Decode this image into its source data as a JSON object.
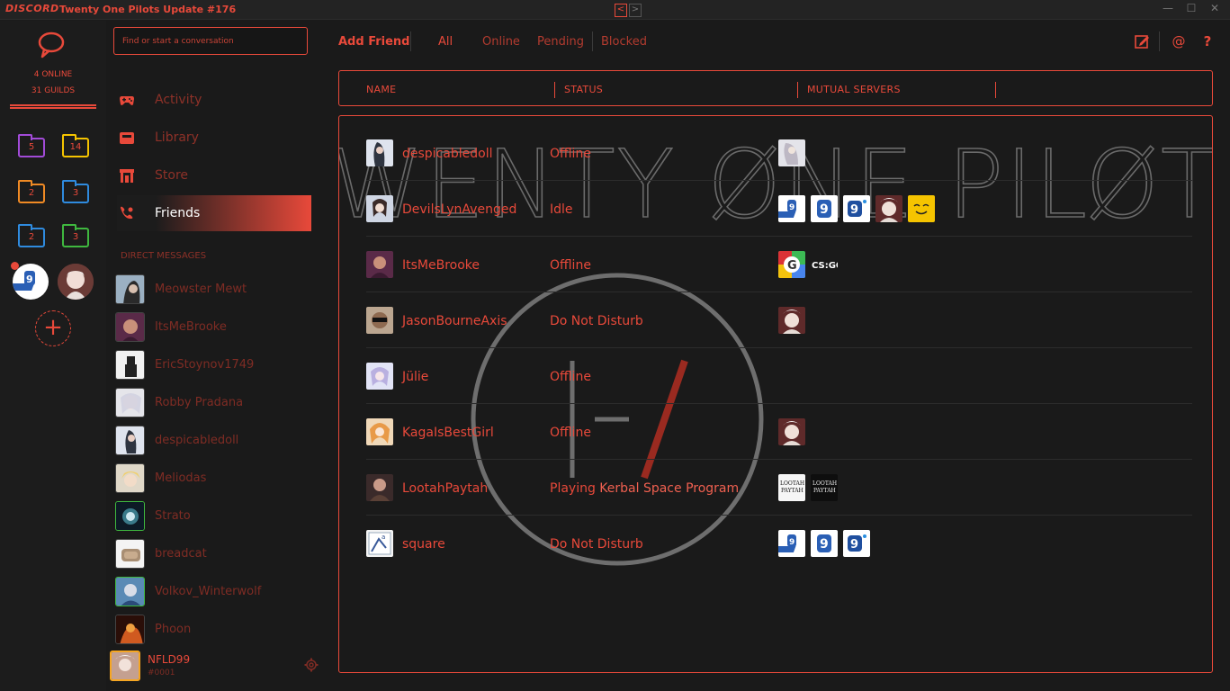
{
  "titlebar": {
    "brand": "DISCORD",
    "title": "Twenty One Pilots Update #176",
    "back": "<",
    "forward": ">",
    "minimize": "—",
    "maximize": "☐",
    "close": "✕"
  },
  "guilds": {
    "online": "4 ONLINE",
    "guilds": "31 GUILDS",
    "folders": [
      {
        "count": "5",
        "color": "#a24bd8"
      },
      {
        "count": "14",
        "color": "#f5c400"
      },
      {
        "count": "2",
        "color": "#f08a24"
      },
      {
        "count": "3",
        "color": "#2f8bdf"
      },
      {
        "count": "2",
        "color": "#2f8bdf"
      },
      {
        "count": "3",
        "color": "#3fb83f"
      }
    ],
    "add_label": "+"
  },
  "sidebar": {
    "search_placeholder": "Find or start a conversation",
    "nav": [
      {
        "label": "Activity",
        "icon": "gamepad-icon"
      },
      {
        "label": "Library",
        "icon": "library-icon"
      },
      {
        "label": "Store",
        "icon": "store-icon"
      },
      {
        "label": "Friends",
        "icon": "friends-icon"
      }
    ],
    "dm_header": "DIRECT MESSAGES",
    "dms": [
      "Meowster Mewt",
      "ItsMeBrooke",
      "EricStoynov1749",
      "Robby Pradana",
      "despicabledoll",
      "Meliodas",
      "Strato",
      "breadcat",
      "Volkov_Winterwolf",
      "Phoon"
    ],
    "user": {
      "name": "NFLD99",
      "tag": "#0001"
    }
  },
  "topbar": {
    "add_friend": "Add Friend",
    "tabs": [
      "All",
      "Online",
      "Pending",
      "Blocked"
    ],
    "icons": [
      "new-dm-icon",
      "mention-icon",
      "help-icon"
    ],
    "mention": "@",
    "help": "?"
  },
  "table": {
    "headers": [
      "NAME",
      "STATUS",
      "MUTUAL SERVERS"
    ],
    "watermark": "TWENTY ØNE PILØTS",
    "rows": [
      {
        "name": "despicabledoll",
        "status": "Offline",
        "game": "",
        "servers": 1
      },
      {
        "name": "DevilsLynAvenged",
        "status": "Idle",
        "game": "",
        "servers": 5
      },
      {
        "name": "ItsMeBrooke",
        "status": "Offline",
        "game": "",
        "servers": 2
      },
      {
        "name": "JasonBourneAxis",
        "status": "Do Not Disturb",
        "game": "",
        "servers": 1
      },
      {
        "name": "Jülie",
        "status": "Offline",
        "game": "",
        "servers": 0
      },
      {
        "name": "KagaIsBestGirl",
        "status": "Offline",
        "game": "",
        "servers": 1
      },
      {
        "name": "LootahPaytah",
        "status": "Playing ",
        "game": "Kerbal Space Program",
        "servers": 2
      },
      {
        "name": "square",
        "status": "Do Not Disturb",
        "game": "",
        "servers": 3
      }
    ]
  },
  "colors": {
    "accent": "#e8493a",
    "background": "#1a1a1a"
  }
}
